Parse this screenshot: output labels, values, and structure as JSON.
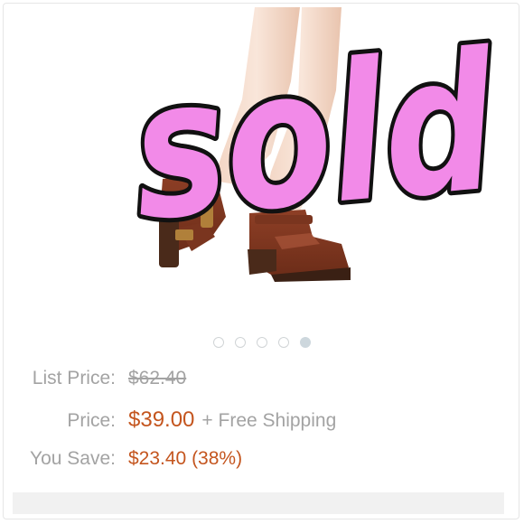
{
  "overlay": {
    "sold_text": "sold",
    "fill_color": "#f28ae8",
    "outline_color": "#111111"
  },
  "photo": {
    "subject": "brown cut-out heeled ankle boots on model's legs"
  },
  "carousel": {
    "total": 5,
    "active_index": 4
  },
  "pricing": {
    "list_price_label": "List Price:",
    "list_price_value": "$62.40",
    "price_label": "Price:",
    "price_value": "$39.00",
    "shipping_note": "+ Free Shipping",
    "you_save_label": "You Save:",
    "you_save_value": "$23.40 (38%)",
    "accent_color": "#c4551e",
    "muted_color": "#a3a3a3"
  }
}
